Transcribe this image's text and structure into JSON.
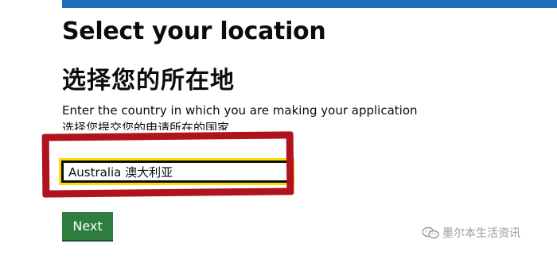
{
  "page": {
    "title_en": "Select your location",
    "title_zh": "选择您的所在地",
    "hint_en": "Enter the country in which you are making your application",
    "hint_zh": "选择您提交您的申请所在的国家",
    "country_value": "Australia 澳大利亚",
    "next_label": "Next"
  },
  "watermark": {
    "text": "墨尔本生活资讯",
    "icon": "wechat-icon"
  },
  "colors": {
    "top_bar": "#1d70b8",
    "button": "#2f7d3f",
    "focus": "#ffdd00",
    "annotation": "#b0131c"
  }
}
